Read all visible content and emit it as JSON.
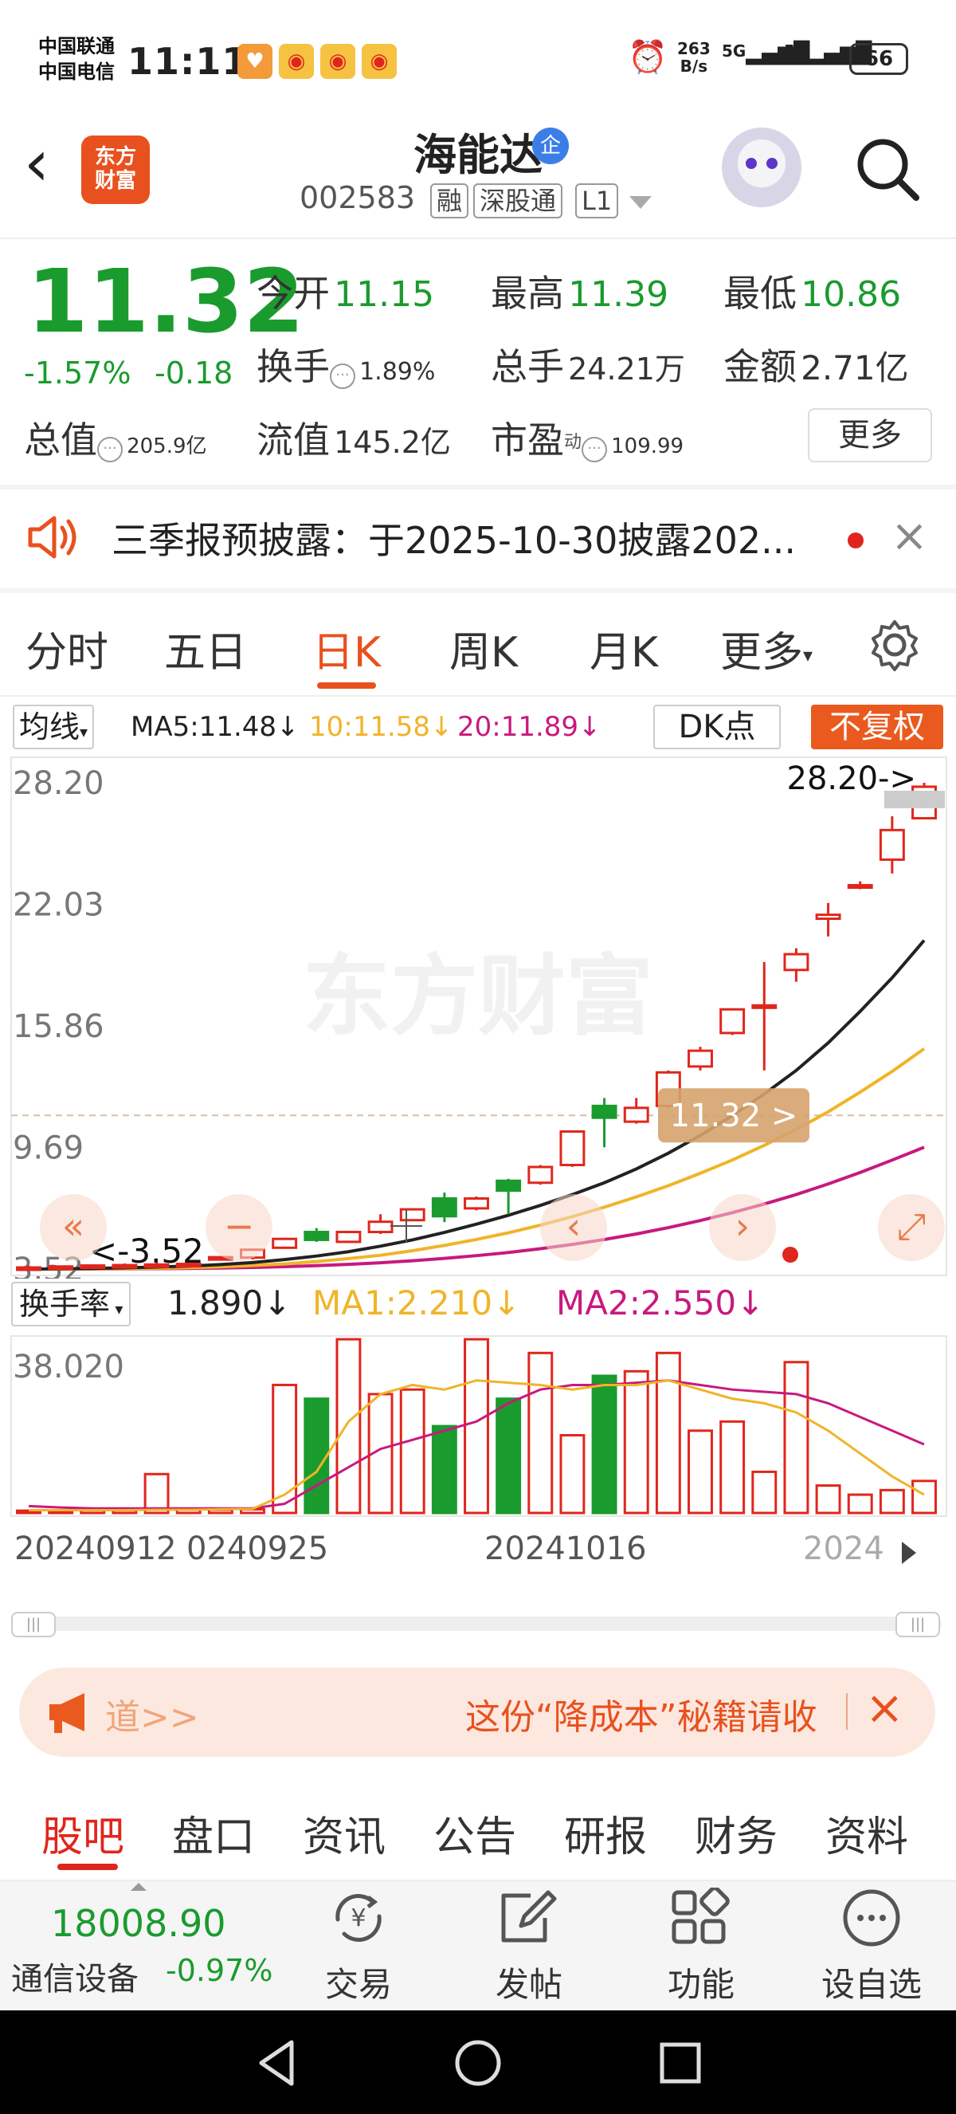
{
  "status_bar": {
    "carrier1": "中国联通",
    "carrier2": "中国电信",
    "time": "11:11",
    "net_speed_top": "263",
    "net_speed_bottom": "B/s",
    "signal1": "5G",
    "signal2": "5G",
    "battery": "66"
  },
  "header": {
    "logo_line1": "东方",
    "logo_line2": "财富",
    "stock_name": "海能达",
    "corp_badge": "企",
    "stock_code": "002583",
    "tags": [
      "融",
      "深股通",
      "L1"
    ]
  },
  "quote": {
    "price": "11.32",
    "change_pct": "-1.57%",
    "change_amt": "-0.18",
    "open_label": "今开",
    "open": "11.15",
    "high_label": "最高",
    "high": "11.39",
    "low_label": "最低",
    "low": "10.86",
    "turnover_label": "换手",
    "turnover": "1.89%",
    "volume_label": "总手",
    "volume": "24.21万",
    "amount_label": "金额",
    "amount": "2.71亿",
    "mktcap_label": "总值",
    "mktcap": "205.9亿",
    "float_label": "流值",
    "float_cap": "145.2亿",
    "pe_label": "市盈",
    "pe_sup": "动",
    "pe": "109.99",
    "more_button": "更多"
  },
  "notice": {
    "text": "三季报预披露：于2025-10-30披露202..."
  },
  "kline_tabs": [
    "分时",
    "五日",
    "日K",
    "周K",
    "月K",
    "更多"
  ],
  "active_tab": "日K",
  "chart_header": {
    "ma_select": "均线",
    "ma5": "MA5:11.48↓",
    "ma10": "10:11.58↓",
    "ma20": "20:11.89↓",
    "dk_button": "DK点",
    "fq_button": "不复权"
  },
  "price_chart": {
    "y_labels": [
      "28.20",
      "22.03",
      "15.86",
      "9.69",
      "3.52"
    ],
    "max_marker": "28.20->",
    "min_marker": "<-3.52",
    "current_price_marker": "11.32 >",
    "watermark": "东方财富"
  },
  "volume_header": {
    "select": "换手率",
    "value": "1.890↓",
    "ma1": "MA1:2.210↓",
    "ma2": "MA2:2.550↓",
    "y_label": "38.020"
  },
  "x_labels": [
    "20240912",
    "0240925",
    "20241016",
    "2024"
  ],
  "colors": {
    "up": "#e0261c",
    "down": "#1a9b2e",
    "ma5": "#222222",
    "ma10": "#f0b428",
    "ma20": "#c8197e",
    "accent": "#e8511f"
  },
  "chart_data": {
    "type": "candlestick",
    "y_range": [
      3.52,
      28.2
    ],
    "candles": [
      {
        "open": 3.52,
        "close": 3.6,
        "high": 3.7,
        "low": 3.5
      },
      {
        "open": 3.6,
        "close": 3.65,
        "high": 3.7,
        "low": 3.55
      },
      {
        "open": 3.65,
        "close": 3.7,
        "high": 3.75,
        "low": 3.6
      },
      {
        "open": 3.7,
        "close": 3.72,
        "high": 3.8,
        "low": 3.62
      },
      {
        "open": 3.72,
        "close": 3.75,
        "high": 3.85,
        "low": 3.65
      },
      {
        "open": 3.75,
        "close": 3.78,
        "high": 3.9,
        "low": 3.7
      },
      {
        "open": 4.0,
        "close": 4.12,
        "high": 4.12,
        "low": 4.0
      },
      {
        "open": 4.1,
        "close": 4.5,
        "high": 4.5,
        "low": 4.0
      },
      {
        "open": 4.6,
        "close": 5.05,
        "high": 5.1,
        "low": 4.55
      },
      {
        "open": 5.4,
        "close": 5.0,
        "high": 5.6,
        "low": 4.9
      },
      {
        "open": 4.9,
        "close": 5.4,
        "high": 5.45,
        "low": 4.85
      },
      {
        "open": 5.4,
        "close": 5.92,
        "high": 6.3,
        "low": 5.3
      },
      {
        "open": 6.0,
        "close": 6.55,
        "high": 6.6,
        "low": 5.95
      },
      {
        "open": 7.1,
        "close": 6.2,
        "high": 7.4,
        "low": 5.9
      },
      {
        "open": 6.6,
        "close": 7.1,
        "high": 7.2,
        "low": 6.5
      },
      {
        "open": 8.0,
        "close": 7.5,
        "high": 8.1,
        "low": 6.3
      },
      {
        "open": 7.9,
        "close": 8.7,
        "high": 8.8,
        "low": 7.8
      },
      {
        "open": 8.8,
        "close": 10.5,
        "high": 10.5,
        "low": 8.7
      },
      {
        "open": 11.8,
        "close": 11.2,
        "high": 12.2,
        "low": 9.7
      },
      {
        "open": 11.0,
        "close": 11.7,
        "high": 12.2,
        "low": 10.9
      },
      {
        "open": 11.8,
        "close": 13.5,
        "high": 13.6,
        "low": 11.7
      },
      {
        "open": 13.8,
        "close": 14.6,
        "high": 14.8,
        "low": 13.6
      },
      {
        "open": 15.5,
        "close": 16.7,
        "high": 16.7,
        "low": 15.4
      },
      {
        "open": 16.8,
        "close": 16.9,
        "high": 19.1,
        "low": 13.6
      },
      {
        "open": 18.7,
        "close": 19.5,
        "high": 19.8,
        "low": 18.1
      },
      {
        "open": 21.3,
        "close": 21.5,
        "high": 22.1,
        "low": 20.4
      },
      {
        "open": 22.9,
        "close": 23.0,
        "high": 23.2,
        "low": 22.8
      },
      {
        "open": 24.3,
        "close": 25.8,
        "high": 26.5,
        "low": 23.6
      },
      {
        "open": 26.4,
        "close": 28.0,
        "high": 28.2,
        "low": 26.4
      }
    ],
    "ma5": [
      3.52,
      3.53,
      3.55,
      3.58,
      3.62,
      3.67,
      3.75,
      3.85,
      4.0,
      4.18,
      4.4,
      4.68,
      5.0,
      5.38,
      5.8,
      6.25,
      6.75,
      7.3,
      7.9,
      8.6,
      9.4,
      10.3,
      11.3,
      12.4,
      13.6,
      15.0,
      16.6,
      18.3,
      20.2
    ],
    "ma10": [
      3.52,
      3.52,
      3.53,
      3.54,
      3.56,
      3.59,
      3.63,
      3.7,
      3.78,
      3.9,
      4.05,
      4.22,
      4.45,
      4.72,
      5.02,
      5.36,
      5.75,
      6.18,
      6.66,
      7.18,
      7.75,
      8.38,
      9.05,
      9.8,
      10.6,
      11.5,
      12.5,
      13.55,
      14.7
    ],
    "ma20": [
      3.52,
      3.52,
      3.52,
      3.53,
      3.54,
      3.55,
      3.57,
      3.6,
      3.64,
      3.69,
      3.76,
      3.84,
      3.94,
      4.06,
      4.2,
      4.36,
      4.55,
      4.77,
      5.02,
      5.3,
      5.62,
      5.98,
      6.38,
      6.82,
      7.3,
      7.84,
      8.42,
      9.05,
      9.7
    ],
    "volume_y_max": 38.02,
    "turnover": [
      0.5,
      0.5,
      0.6,
      0.6,
      8.5,
      0.7,
      0.7,
      0.8,
      28.0,
      25.0,
      38.0,
      26.0,
      27.0,
      19.0,
      38.0,
      25.0,
      35.0,
      17.0,
      30.0,
      31.0,
      35.0,
      18.0,
      20.0,
      9.0,
      33.0,
      6.0,
      4.0,
      5.0,
      7.0
    ],
    "turnover_ma1": [
      0.6,
      0.6,
      0.6,
      0.6,
      0.7,
      0.7,
      0.8,
      0.9,
      4.0,
      9.0,
      20.0,
      26.0,
      28.0,
      27.0,
      29.0,
      28.5,
      28.0,
      27.0,
      28.0,
      28.0,
      29.0,
      27.0,
      25.0,
      24.0,
      22.0,
      18.0,
      13.0,
      8.0,
      4.0
    ],
    "turnover_ma2": [
      1.5,
      1.2,
      1.0,
      1.0,
      1.0,
      1.0,
      1.0,
      1.0,
      2.0,
      6.0,
      10.0,
      14.0,
      16.0,
      18.0,
      20.0,
      24.0,
      27.0,
      28.0,
      28.0,
      28.5,
      29.0,
      28.0,
      27.0,
      26.5,
      26.0,
      24.0,
      21.0,
      18.0,
      15.0
    ]
  },
  "promo": {
    "left_text": "道>>",
    "right_text": "这份“降成本”秘籍请收"
  },
  "bottom_tabs": [
    "股吧",
    "盘口",
    "资讯",
    "公告",
    "研报",
    "财务",
    "资料"
  ],
  "active_bottom_tab": "股吧",
  "toolbar": {
    "index_value": "18008.90",
    "sector": "通信设备",
    "sector_change": "-0.97%",
    "trade": "交易",
    "post": "发帖",
    "functions": "功能",
    "watchlist": "设自选"
  }
}
